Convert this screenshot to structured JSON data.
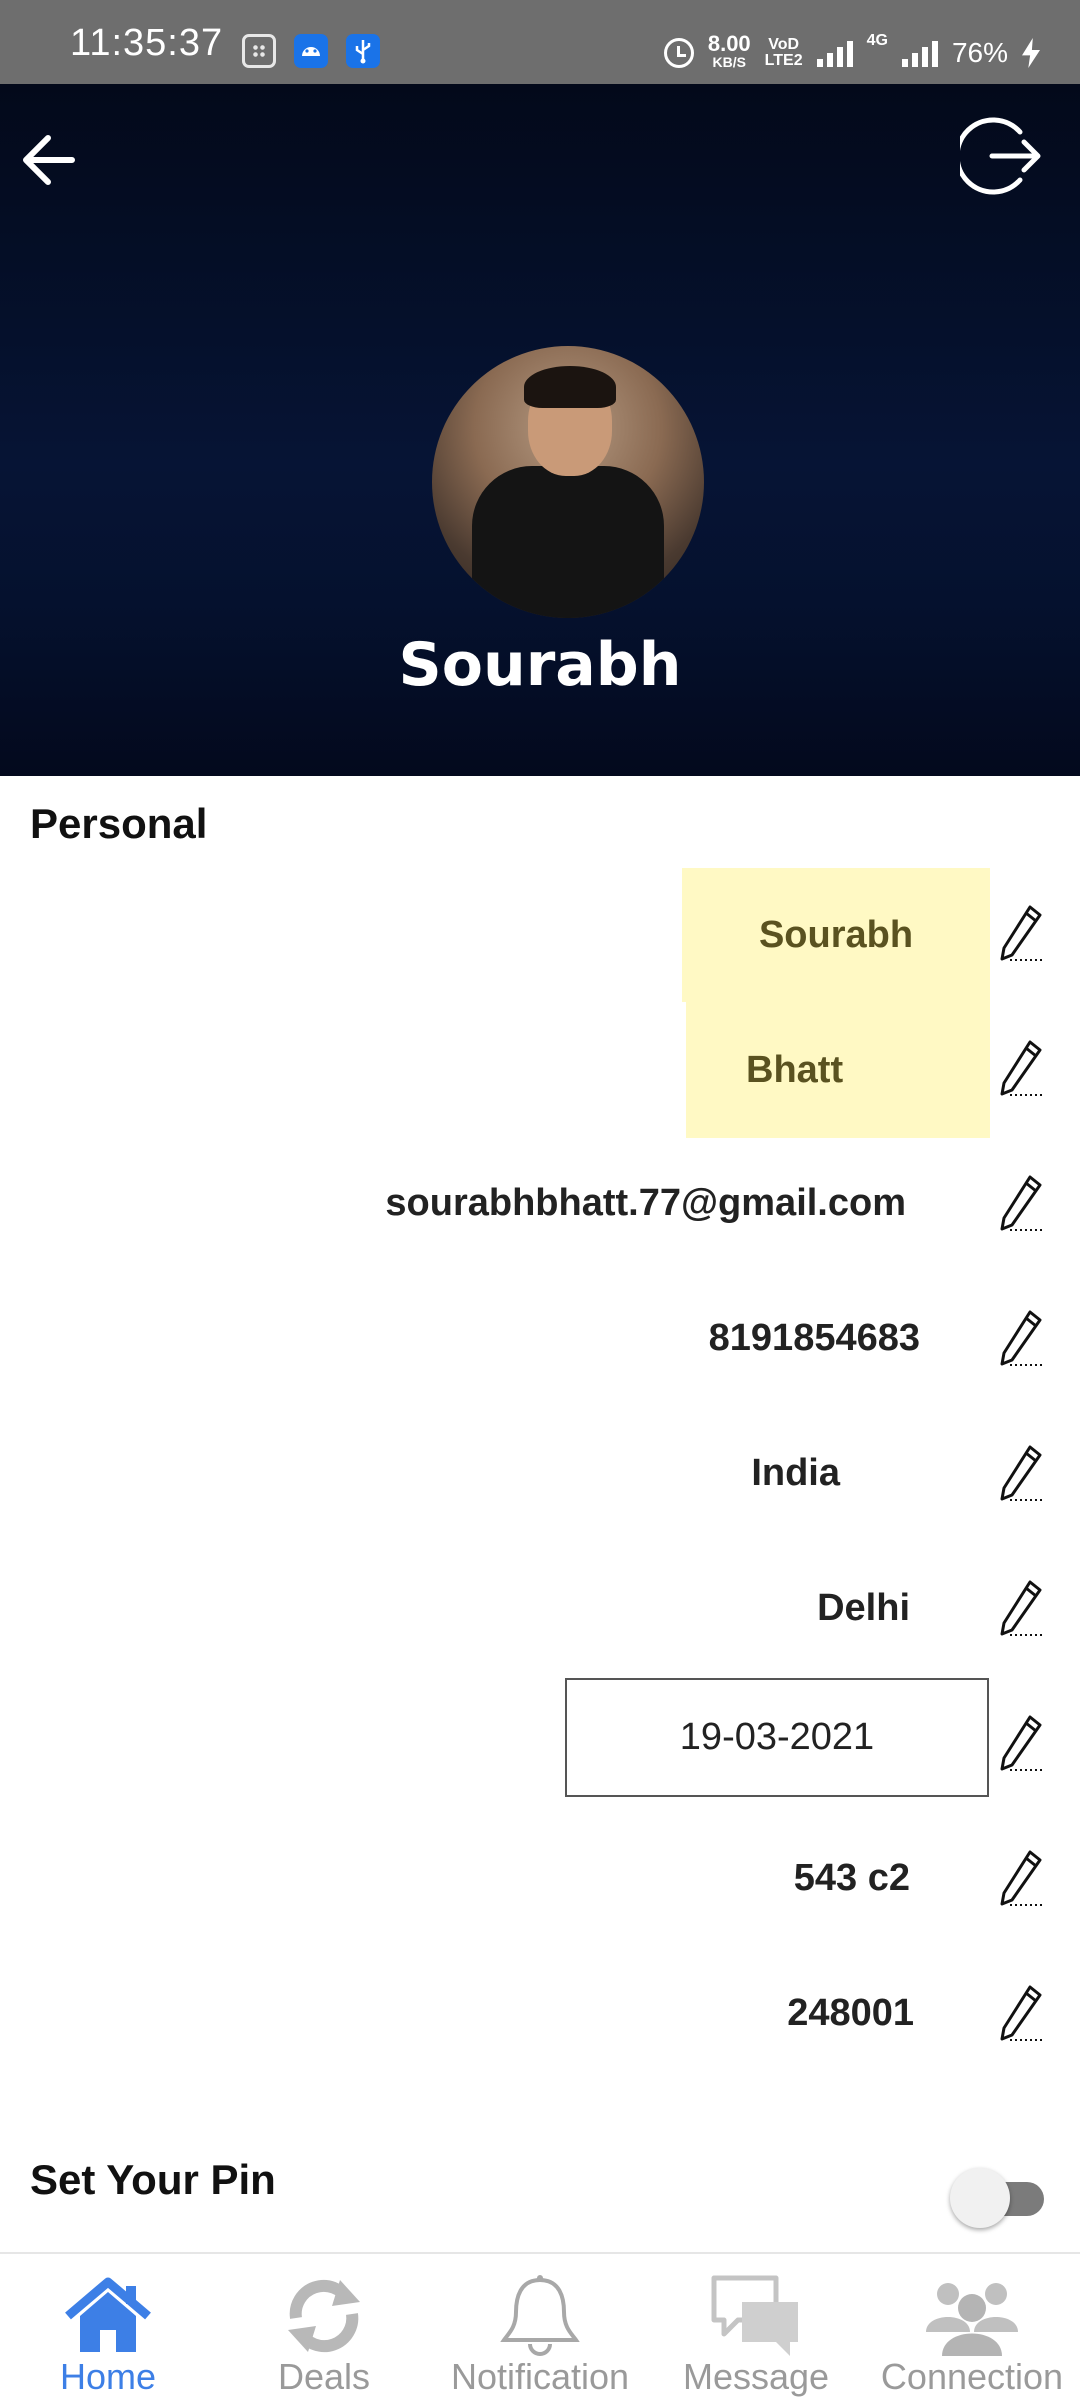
{
  "status_bar": {
    "time": "11:35:37",
    "net_speed_value": "8.00",
    "net_speed_unit": "KB/S",
    "volte_top": "VoD",
    "volte_bottom": "LTE2",
    "network_type": "4G",
    "battery": "76%"
  },
  "profile": {
    "name": "Sourabh"
  },
  "personal": {
    "title": "Personal",
    "first_name": "Sourabh",
    "last_name": "Bhatt",
    "email": "sourabhbhatt.77@gmail.com",
    "phone": "8191854683",
    "country": "India",
    "city": "Delhi",
    "dob": "19-03-2021",
    "address": "543 c2",
    "pincode": "248001"
  },
  "pin": {
    "label": "Set Your Pin",
    "enabled": false
  },
  "nav": {
    "items": [
      {
        "label": "Home",
        "icon": "home-icon",
        "active": true
      },
      {
        "label": "Deals",
        "icon": "deals-icon",
        "active": false
      },
      {
        "label": "Notification",
        "icon": "bell-icon",
        "active": false
      },
      {
        "label": "Message",
        "icon": "message-icon",
        "active": false
      },
      {
        "label": "Connection",
        "icon": "people-icon",
        "active": false
      }
    ]
  },
  "colors": {
    "header_bg": "#061435",
    "highlight": "#fff9c4",
    "accent": "#3d7fe6",
    "inactive": "#9a9a9a"
  }
}
